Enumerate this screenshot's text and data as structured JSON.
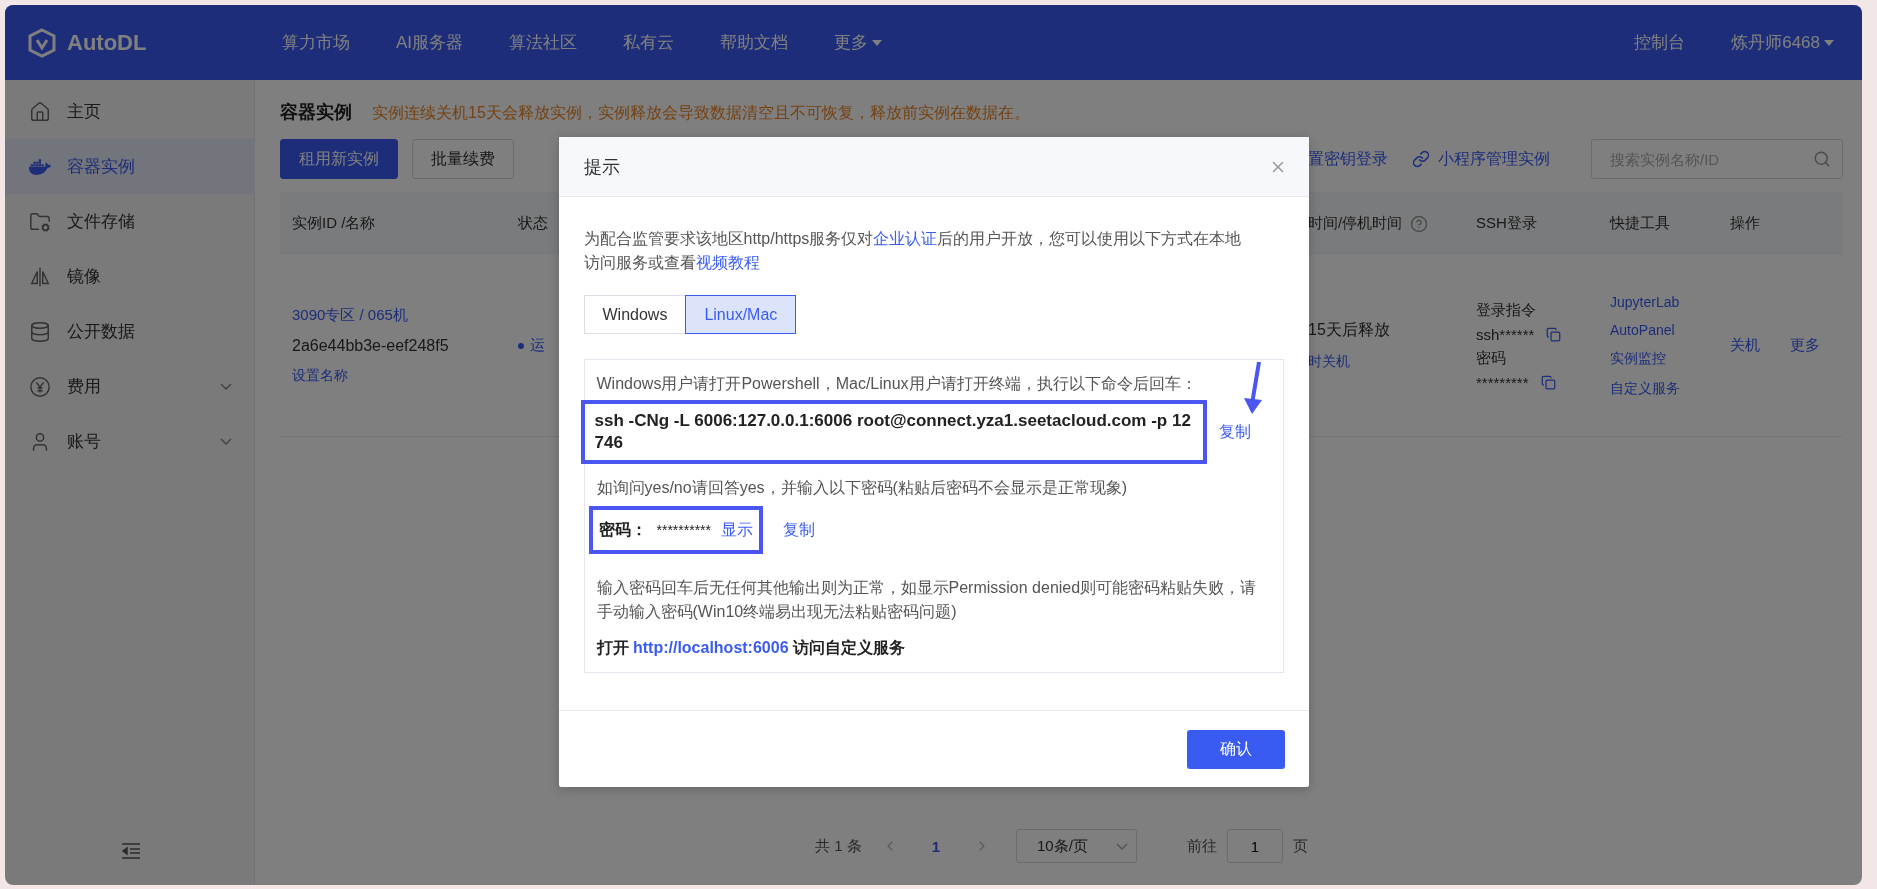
{
  "header": {
    "logo": "AutoDL",
    "nav": [
      {
        "label": "算力市场",
        "dropdown": false
      },
      {
        "label": "AI服务器",
        "dropdown": false
      },
      {
        "label": "算法社区",
        "dropdown": false
      },
      {
        "label": "私有云",
        "dropdown": false
      },
      {
        "label": "帮助文档",
        "dropdown": false
      },
      {
        "label": "更多",
        "dropdown": true
      }
    ],
    "right": [
      {
        "label": "控制台",
        "dropdown": false
      },
      {
        "label": "炼丹师6468",
        "dropdown": true
      }
    ]
  },
  "sidebar": {
    "items": [
      {
        "label": "主页",
        "selected": false,
        "expandable": false
      },
      {
        "label": "容器实例",
        "selected": true,
        "expandable": false
      },
      {
        "label": "文件存储",
        "selected": false,
        "expandable": false
      },
      {
        "label": "镜像",
        "selected": false,
        "expandable": false
      },
      {
        "label": "公开数据",
        "selected": false,
        "expandable": false
      },
      {
        "label": "费用",
        "selected": false,
        "expandable": true
      },
      {
        "label": "账号",
        "selected": false,
        "expandable": true
      }
    ]
  },
  "page": {
    "title": "容器实例",
    "notice": "实例连续关机15天会释放实例，实例释放会导致数据清空且不可恢复，释放前实例在数据在。",
    "buttons": [
      {
        "label": "租用新实例",
        "primary": true
      },
      {
        "label": "批量续费",
        "primary": false
      }
    ],
    "links": [
      {
        "label": "置密钥登录",
        "has_icon": false
      },
      {
        "label": "小程序管理实例",
        "has_icon": true
      }
    ],
    "search": {
      "placeholder": "搜索实例名称/ID"
    }
  },
  "table": {
    "columns": [
      {
        "label": "实例ID /名称",
        "help": false
      },
      {
        "label": "状态",
        "help": false
      },
      {
        "label": "时间/停机时间",
        "help": true
      },
      {
        "label": "SSH登录",
        "help": false
      },
      {
        "label": "快捷工具",
        "help": false
      },
      {
        "label": "操作",
        "help": false
      }
    ],
    "rows": [
      {
        "name": "3090专区 / 065机",
        "id": "2a6e44bb3e-eef248f5",
        "rename": "设置名称",
        "status": "运",
        "release": "15天后释放",
        "release_link": "时关机",
        "ssh": [
          {
            "label": "登录指令",
            "copy": false
          },
          {
            "label": "ssh******",
            "copy": true
          },
          {
            "label": "密码",
            "copy": false
          },
          {
            "label": "*********",
            "copy": true
          }
        ],
        "tools": [
          "JupyterLab",
          "AutoPanel",
          "实例监控",
          "自定义服务"
        ],
        "actions": [
          "关机",
          "更多"
        ]
      }
    ]
  },
  "pagination": {
    "total": "共 1 条",
    "pages": [
      {
        "label": "1",
        "selected": true
      }
    ],
    "page_size": "10条/页",
    "goto_label": "前往",
    "goto_value": "1",
    "goto_suffix": "页"
  },
  "dialog": {
    "title": "提示",
    "intro": [
      {
        "text": "为配合监管要求该地区http/https服务仅对",
        "link": false
      },
      {
        "text": "企业认证",
        "link": true
      },
      {
        "text": "后的用户开放，您可以使用以下方式在本地访问服务或查看",
        "link": false
      },
      {
        "text": "视频教程",
        "link": true
      }
    ],
    "tabs": [
      {
        "label": "Windows",
        "selected": false
      },
      {
        "label": "Linux/Mac",
        "selected": true
      }
    ],
    "instruction": "Windows用户请打开Powershell，Mac/Linux用户请打开终端，执行以下命令后回车：",
    "command": "ssh -CNg -L 6006:127.0.0.1:6006 root@connect.yza1.seetacloud.com -p 12746",
    "command_copy": "复制",
    "hint": "如询问yes/no请回答yes，并输入以下密码(粘贴后密码不会显示是正常现象)",
    "password_label": "密码：",
    "password_value": "**********",
    "show_label": "显示",
    "password_copy": "复制",
    "note": "输入密码回车后无任何其他输出则为正常，如显示Permission denied则可能密码粘贴失败，请手动输入密码(Win10终端易出现无法粘贴密码问题)",
    "open": {
      "prefix": "打开",
      "url": "http://localhost:6006",
      "suffix": "访问自定义服务"
    },
    "confirm": "确认"
  }
}
